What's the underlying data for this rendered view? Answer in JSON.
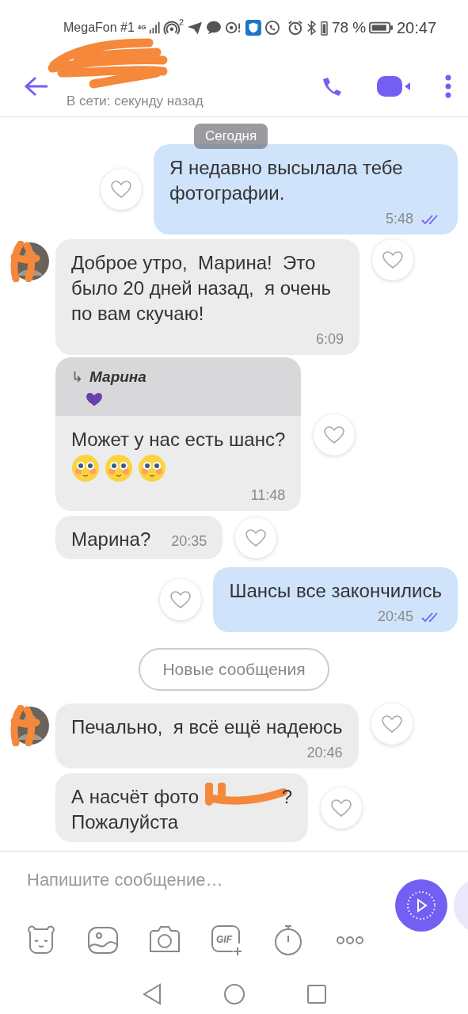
{
  "status_bar": {
    "carrier": "MegaFon #1",
    "network_type": "4G",
    "hotspot_count": "2",
    "battery_percent": "78 %",
    "time": "20:47"
  },
  "header": {
    "name_redacted": true,
    "presence": "В сети: секунду назад"
  },
  "date_badge": "Сегодня",
  "messages": [
    {
      "kind": "outgoing",
      "text": "Я недавно высылала тебе фотографии.",
      "time": "5:48",
      "read": true,
      "liked": false
    },
    {
      "kind": "incoming",
      "text": "Доброе утро,  Марина!  Это было 20 дней назад,  я очень по вам скучаю!",
      "time": "6:09",
      "liked": false,
      "avatar": true
    },
    {
      "kind": "incoming",
      "reply": {
        "author": "Марина",
        "arrow": "↳"
      },
      "text": "Может у нас есть шанс?",
      "emojis": [
        {
          "kind": "pleading"
        },
        {
          "kind": "pleading"
        },
        {
          "kind": "pleading"
        }
      ],
      "time": "11:48",
      "liked": false
    },
    {
      "kind": "incoming",
      "text": "Марина?",
      "time": "20:35",
      "time_inline": true,
      "liked": false
    },
    {
      "kind": "outgoing",
      "text": "Шансы все закончились",
      "time": "20:45",
      "read": true,
      "liked": false
    },
    {
      "kind": "divider",
      "text": "Новые сообщения"
    },
    {
      "kind": "incoming",
      "text": "Печально,  я всё ещё надеюсь",
      "time": "20:46",
      "liked": false,
      "avatar": true
    },
    {
      "kind": "incoming",
      "text": "А насчёт фото",
      "redacted_tail": "?",
      "text_line2": "Пожалуйста",
      "liked": false
    }
  ],
  "composer": {
    "placeholder": "Напишите сообщение…",
    "gif_label": "GIF",
    "tools": [
      {
        "kind": "sticker"
      },
      {
        "kind": "gallery"
      },
      {
        "kind": "camera"
      },
      {
        "kind": "gif"
      },
      {
        "kind": "timer"
      },
      {
        "kind": "more"
      }
    ]
  }
}
